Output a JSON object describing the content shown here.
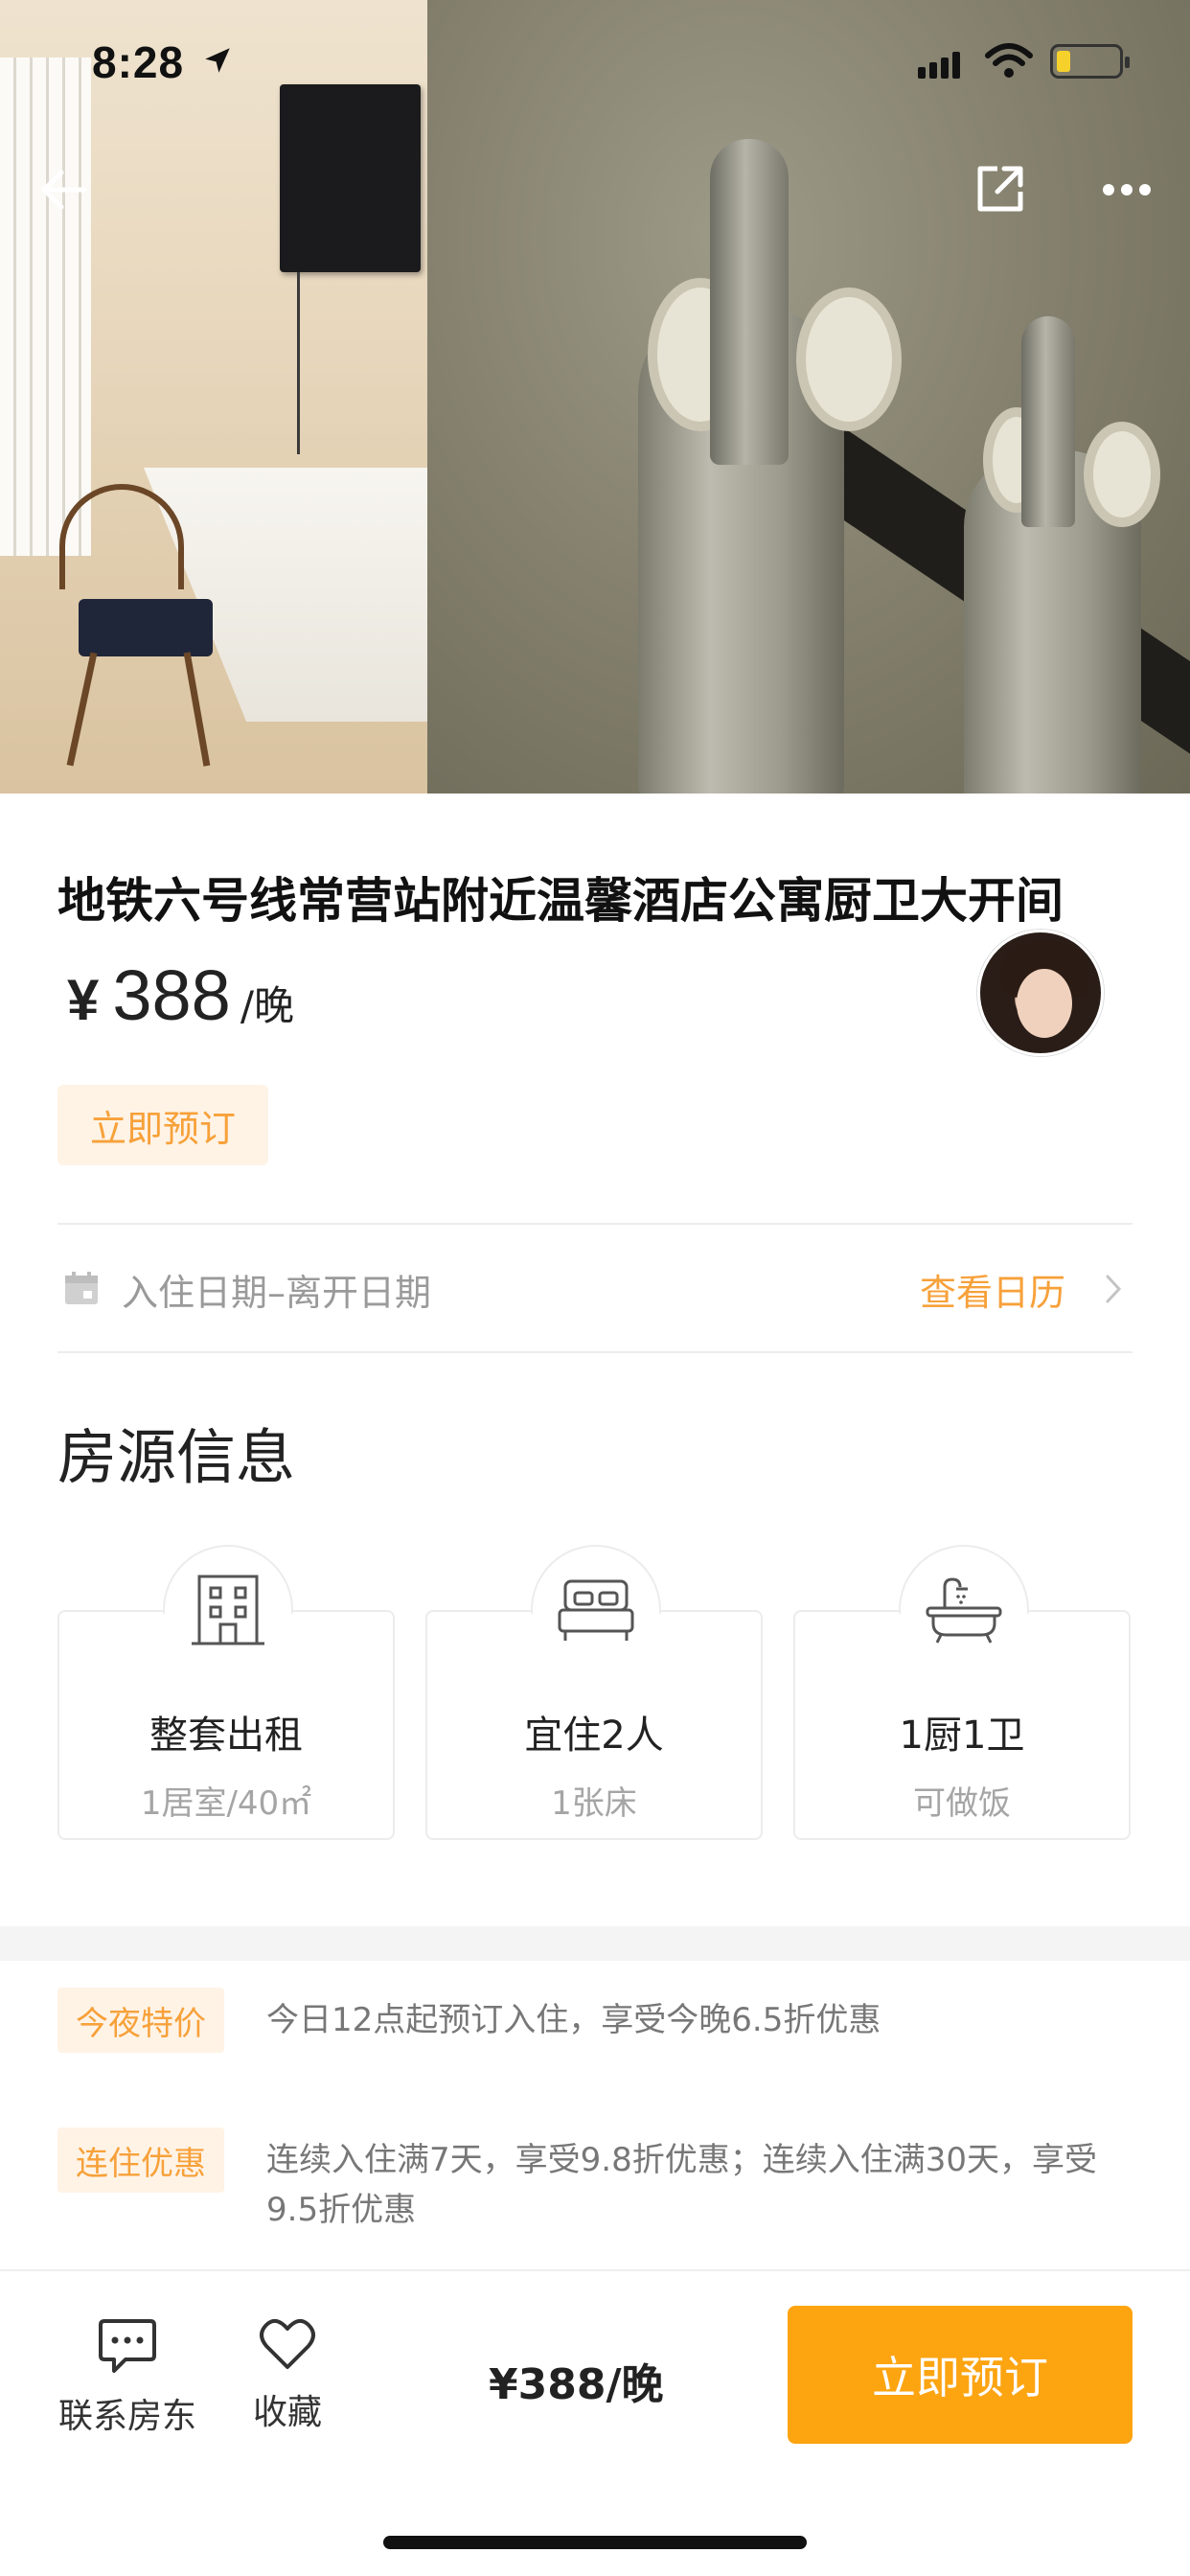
{
  "status_bar": {
    "time": "8:28"
  },
  "listing": {
    "title": "地铁六号线常营站附近温馨酒店公寓厨卫大开间",
    "price_currency": "¥",
    "price_amount": "388",
    "price_unit": "/晚",
    "book_tag": "立即预订"
  },
  "dates": {
    "placeholder": "入住日期–离开日期",
    "calendar_link": "查看日历"
  },
  "house_info": {
    "section_title": "房源信息",
    "cards": [
      {
        "icon": "building-icon",
        "main": "整套出租",
        "sub": "1居室/40㎡"
      },
      {
        "icon": "bed-icon",
        "main": "宜住2人",
        "sub": "1张床"
      },
      {
        "icon": "bathtub-icon",
        "main": "1厨1卫",
        "sub": "可做饭"
      }
    ]
  },
  "promotions": [
    {
      "tag": "今夜特价",
      "text": "今日12点起预订入住，享受今晚6.5折优惠"
    },
    {
      "tag": "连住优惠",
      "text": "连续入住满7天，享受9.8折优惠；连续入住满30天，享受9.5折优惠"
    }
  ],
  "bottom_bar": {
    "contact_label": "联系房东",
    "favorite_label": "收藏",
    "price": "¥388/晚",
    "book_button": "立即预订"
  },
  "colors": {
    "accent": "#f7a13a",
    "book_button": "#fda411",
    "tag_bg": "#fff3e6"
  }
}
